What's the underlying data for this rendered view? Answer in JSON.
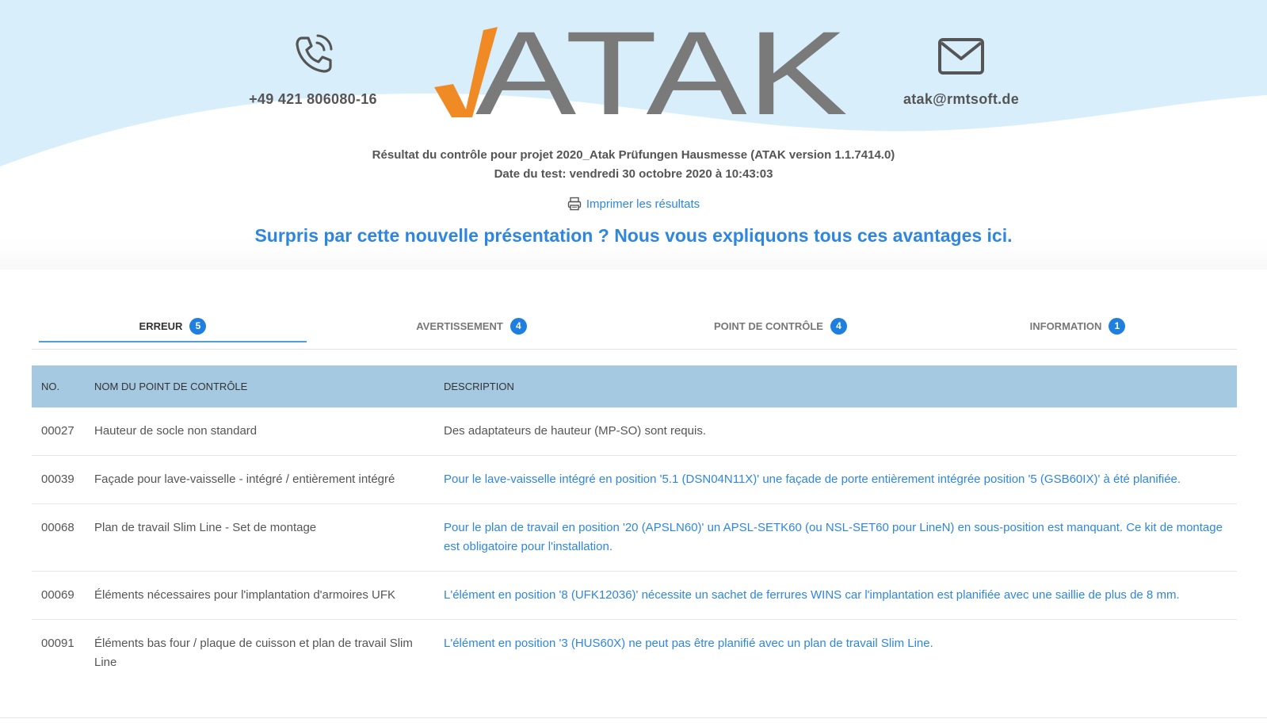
{
  "header": {
    "phone": "+49 421 806080-16",
    "email": "atak@rmtsoft.de",
    "logo_text": "ATAK",
    "colors": {
      "wave": "#d9eefb",
      "logo_check": "#f08a24",
      "logo_letters": "#7a7a7a"
    }
  },
  "report": {
    "result_line": "Résultat du contrôle pour projet 2020_Atak Prüfungen Hausmesse (ATAK version 1.1.7414.0)",
    "date_line": "Date du test: vendredi 30 octobre 2020 à 10:43:03",
    "print_label": "Imprimer les résultats",
    "promo": "Surpris par cette nouvelle présentation ? Nous vous expliquons tous ces avantages ici."
  },
  "tabs": [
    {
      "label": "ERREUR",
      "count": "5",
      "active": true
    },
    {
      "label": "AVERTISSEMENT",
      "count": "4",
      "active": false
    },
    {
      "label": "POINT DE CONTRÔLE",
      "count": "4",
      "active": false
    },
    {
      "label": "INFORMATION",
      "count": "1",
      "active": false
    }
  ],
  "table": {
    "headers": {
      "no": "NO.",
      "name": "NOM DU POINT DE CONTRÔLE",
      "desc": "DESCRIPTION"
    },
    "rows": [
      {
        "no": "00027",
        "name": "Hauteur de socle non standard",
        "desc": "Des adaptateurs de hauteur (MP-SO) sont requis."
      },
      {
        "no": "00039",
        "name": "Façade pour lave-vaisselle - intégré / entièrement intégré",
        "desc": "Pour le lave-vaisselle intégré en position '5.1 (DSN04N11X)' une façade de porte entièrement intégrée position '5 (GSB60IX)' à été planifiée."
      },
      {
        "no": "00068",
        "name": "Plan de travail Slim Line - Set de montage",
        "desc": "Pour le plan de travail en position '20 (APSLN60)' un APSL-SETK60 (ou NSL-SET60 pour LineN) en sous-position est manquant. Ce kit de montage est obligatoire pour l'installation."
      },
      {
        "no": "00069",
        "name": "Éléments nécessaires pour l'implantation d'armoires UFK",
        "desc": "L'élément en position '8 (UFK12036)' nécessite un sachet de ferrures WINS car l'implantation est planifiée avec une saillie de plus de 8 mm."
      },
      {
        "no": "00091",
        "name": "Éléments bas four / plaque de cuisson et plan de travail Slim Line",
        "desc": "L'élément en position '3 (HUS60X) ne peut pas être planifié avec un plan de travail Slim Line."
      }
    ]
  }
}
